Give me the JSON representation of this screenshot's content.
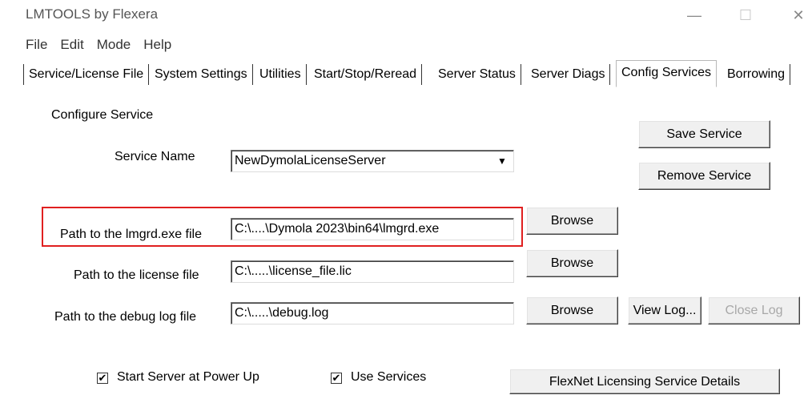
{
  "window": {
    "title": "LMTOOLS by Flexera",
    "controls": {
      "minimize": "—",
      "maximize": "☐",
      "close": "✕"
    }
  },
  "menu": [
    "File",
    "Edit",
    "Mode",
    "Help"
  ],
  "tabs": [
    "Service/License File",
    "System Settings",
    "Utilities",
    "Start/Stop/Reread",
    "Server Status",
    "Server Diags",
    "Config Services",
    "Borrowing"
  ],
  "active_tab": "Config Services",
  "config": {
    "section_label": "Configure Service",
    "service_name_label": "Service Name",
    "service_name_value": "NewDymolaLicenseServer",
    "lmgrd_label": "Path to the lmgrd.exe file",
    "lmgrd_value": "C:\\....\\Dymola 2023\\bin64\\lmgrd.exe",
    "license_label": "Path to the license file",
    "license_value": "C:\\.....\\license_file.lic",
    "debug_label": "Path to the debug log file",
    "debug_value": "C:\\.....\\debug.log",
    "save_button": "Save Service",
    "remove_button": "Remove Service",
    "browse_button": "Browse",
    "view_log_button": "View Log...",
    "close_log_button": "Close Log",
    "start_power_up_label": "Start Server at Power Up",
    "start_power_up_checked": true,
    "use_services_label": "Use Services",
    "use_services_checked": true,
    "flexnet_button": "FlexNet Licensing Service Details"
  },
  "colors": {
    "highlight": "#e02020"
  }
}
